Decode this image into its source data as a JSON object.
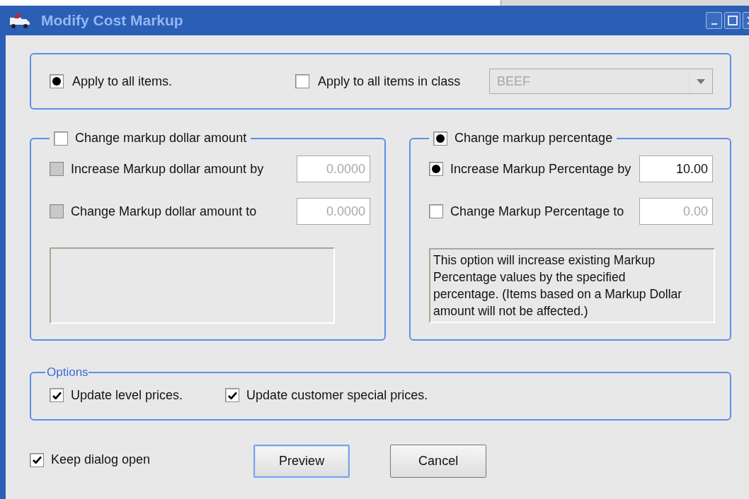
{
  "window": {
    "title": "Modify Cost Markup"
  },
  "scope": {
    "items": [
      {
        "kind": "radio",
        "label": "Apply to all items.",
        "selected": true
      },
      {
        "kind": "checkbox",
        "label": "Apply to all items in class",
        "checked": false
      }
    ],
    "class_dropdown": {
      "value": "BEEF",
      "disabled": true
    }
  },
  "dollar_group": {
    "legend": {
      "kind": "checkbox",
      "label": "Change markup dollar amount",
      "checked": false
    },
    "rows": [
      {
        "kind": "checkbox",
        "label": "Increase Markup dollar amount by",
        "checked": false,
        "disabled": true,
        "value": "0.0000",
        "value_disabled": true
      },
      {
        "kind": "checkbox",
        "label": "Change Markup dollar amount to",
        "checked": false,
        "disabled": true,
        "value": "0.0000",
        "value_disabled": true
      }
    ]
  },
  "percent_group": {
    "legend": {
      "kind": "radio",
      "label": "Change markup percentage",
      "selected": true
    },
    "rows": [
      {
        "kind": "radio",
        "label": "Increase Markup Percentage by",
        "selected": true,
        "value": "10.00",
        "value_disabled": false
      },
      {
        "kind": "checkbox",
        "label": "Change Markup Percentage to",
        "checked": false,
        "value": "0.00",
        "value_disabled": true
      }
    ],
    "note_lines": [
      "This option will increase existing Markup",
      "Percentage values by the specified",
      "percentage. (Items based on a Markup Dollar",
      "amount will not be affected.)"
    ]
  },
  "options": {
    "legend": "Options",
    "items": [
      {
        "kind": "checkbox",
        "label": "Update level prices.",
        "checked": true
      },
      {
        "kind": "checkbox",
        "label": "Update customer special prices.",
        "checked": true
      }
    ]
  },
  "keep_open": {
    "kind": "checkbox",
    "label": "Keep dialog open",
    "checked": true
  },
  "buttons": [
    {
      "label": "Preview",
      "focused": true
    },
    {
      "label": "Cancel",
      "focused": false
    }
  ]
}
